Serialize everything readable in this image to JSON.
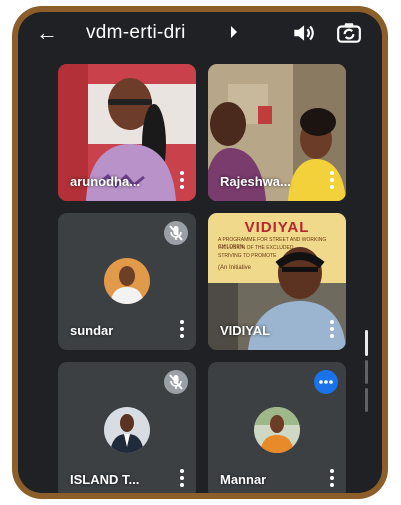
{
  "header": {
    "title": "vdm-erti-dri",
    "back_icon": "arrow-left-icon",
    "audio_icon": "speaker-icon",
    "camera_icon": "switch-camera-icon"
  },
  "participants": [
    {
      "name": "arunodha...",
      "video": true,
      "muted": false
    },
    {
      "name": "Rajeshwa...",
      "video": true,
      "muted": false
    },
    {
      "name": "sundar",
      "video": false,
      "muted": true
    },
    {
      "name": "VIDIYAL",
      "video": true,
      "muted": false
    },
    {
      "name": "ISLAND T...",
      "video": false,
      "muted": true
    },
    {
      "name": "Mannar",
      "video": false,
      "muted": false,
      "speaking": true
    }
  ],
  "banner": {
    "title": "VIDIYAL",
    "lines": [
      "A PROGRAMME FOR STREET AND WORKING CHILDREN",
      "INCLUSION OF THE EXCLUDED",
      "STRIVING TO PROMOTE",
      "(An Initiative"
    ]
  },
  "colors": {
    "frame": "#8b5e2a",
    "background": "#202124",
    "tile": "#3c4043",
    "speaking_badge": "#1a73e8"
  }
}
